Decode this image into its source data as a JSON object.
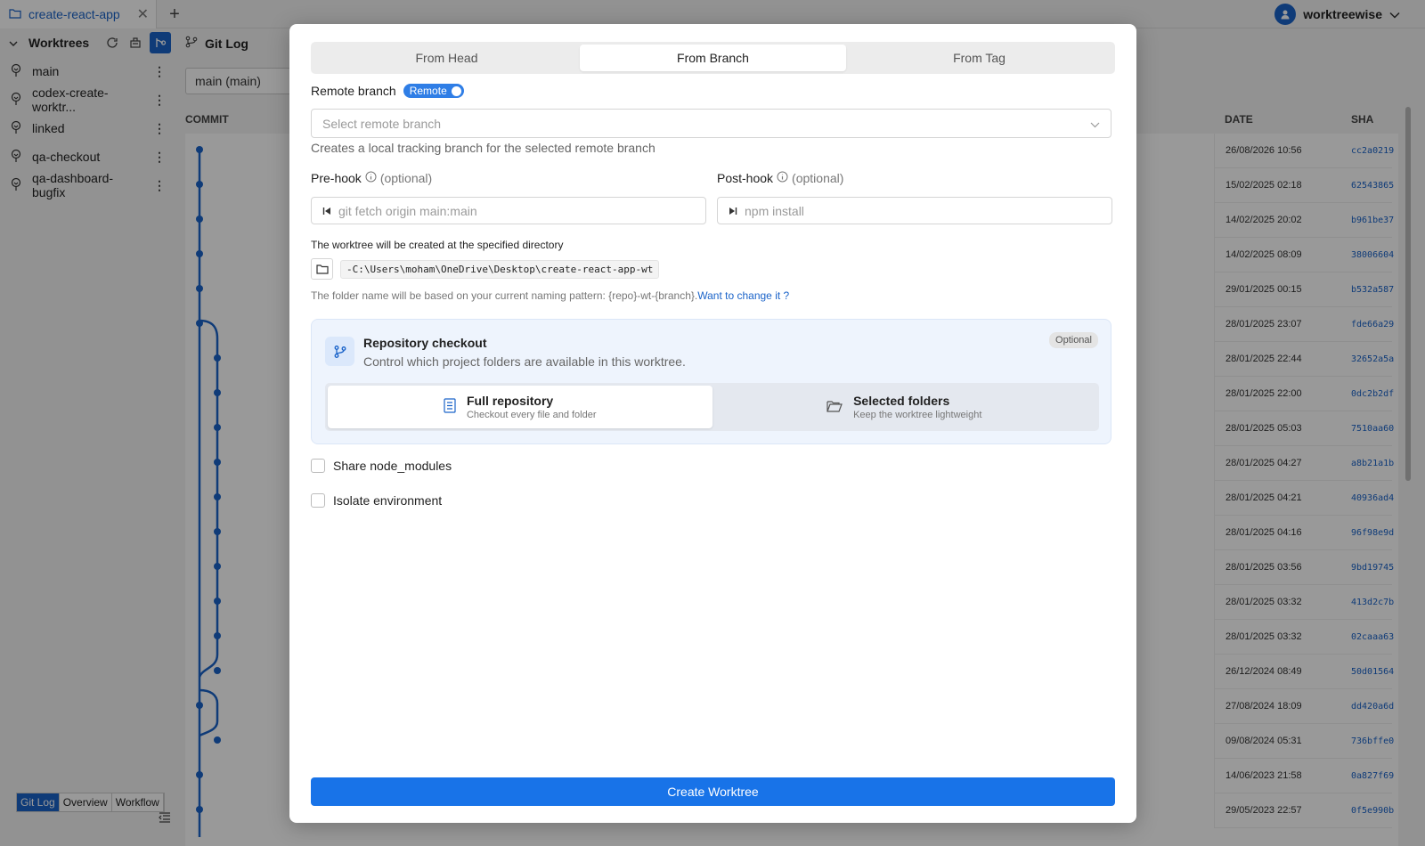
{
  "app": {
    "tab_title": "create-react-app",
    "user_name": "worktreewise"
  },
  "sidebar": {
    "header": "Worktrees",
    "items": [
      {
        "label": "main"
      },
      {
        "label": "codex-create-worktr..."
      },
      {
        "label": "linked"
      },
      {
        "label": "qa-checkout"
      },
      {
        "label": "qa-dashboard-bugfix"
      }
    ],
    "view_tabs": [
      "Git Log",
      "Overview",
      "Workflow"
    ]
  },
  "gitlog": {
    "title": "Git Log",
    "branch_select": "main (main)",
    "columns": {
      "commit": "COMMIT",
      "date": "DATE",
      "sha": "SHA"
    },
    "rows": [
      {
        "date": "26/08/2026 10:56",
        "sha": "cc2a0219"
      },
      {
        "date": "15/02/2025 02:18",
        "sha": "62543865"
      },
      {
        "date": "14/02/2025 20:02",
        "sha": "b961be37"
      },
      {
        "date": "14/02/2025 08:09",
        "sha": "38006604"
      },
      {
        "date": "29/01/2025 00:15",
        "sha": "b532a587"
      },
      {
        "date": "28/01/2025 23:07",
        "sha": "fde66a29"
      },
      {
        "date": "28/01/2025 22:44",
        "sha": "32652a5a"
      },
      {
        "date": "28/01/2025 22:00",
        "sha": "0dc2b2df"
      },
      {
        "date": "28/01/2025 05:03",
        "sha": "7510aa60"
      },
      {
        "date": "28/01/2025 04:27",
        "sha": "a8b21a1b"
      },
      {
        "date": "28/01/2025 04:21",
        "sha": "40936ad4"
      },
      {
        "date": "28/01/2025 04:16",
        "sha": "96f98e9d"
      },
      {
        "date": "28/01/2025 03:56",
        "sha": "9bd19745"
      },
      {
        "date": "28/01/2025 03:32",
        "sha": "413d2c7b"
      },
      {
        "date": "28/01/2025 03:32",
        "sha": "02caaa63"
      },
      {
        "date": "26/12/2024 08:49",
        "sha": "50d01564"
      },
      {
        "date": "27/08/2024 18:09",
        "sha": "dd420a6d"
      },
      {
        "date": "09/08/2024 05:31",
        "sha": "736bffe0"
      },
      {
        "date": "14/06/2023 21:58",
        "sha": "0a827f69"
      },
      {
        "date": "29/05/2023 22:57",
        "sha": "0f5e990b"
      }
    ]
  },
  "modal": {
    "tabs": [
      "From Head",
      "From Branch",
      "From Tag"
    ],
    "active_tab": "From Branch",
    "remote_label": "Remote branch",
    "remote_toggle": "Remote",
    "remote_placeholder": "Select remote branch",
    "remote_helper": "Creates a local tracking branch for the selected remote branch",
    "prehook_label": "Pre-hook",
    "prehook_optional": "(optional)",
    "prehook_placeholder": "git fetch origin main:main",
    "posthook_label": "Post-hook",
    "posthook_optional": "(optional)",
    "posthook_placeholder": "npm install",
    "dir_label": "The worktree will be created at the specified directory",
    "dir_path": "-C:\\Users\\moham\\OneDrive\\Desktop\\create-react-app-wt",
    "pattern_text": "The folder name will be based on your current naming pattern: {repo}-wt-{branch}.",
    "pattern_link": "Want to change it ?",
    "checkout": {
      "title": "Repository checkout",
      "subtitle": "Control which project folders are available in this worktree.",
      "badge": "Optional",
      "full_title": "Full repository",
      "full_sub": "Checkout every file and folder",
      "selected_title": "Selected folders",
      "selected_sub": "Keep the worktree lightweight"
    },
    "share_node_modules": "Share node_modules",
    "isolate_env": "Isolate environment",
    "create_button": "Create Worktree"
  }
}
